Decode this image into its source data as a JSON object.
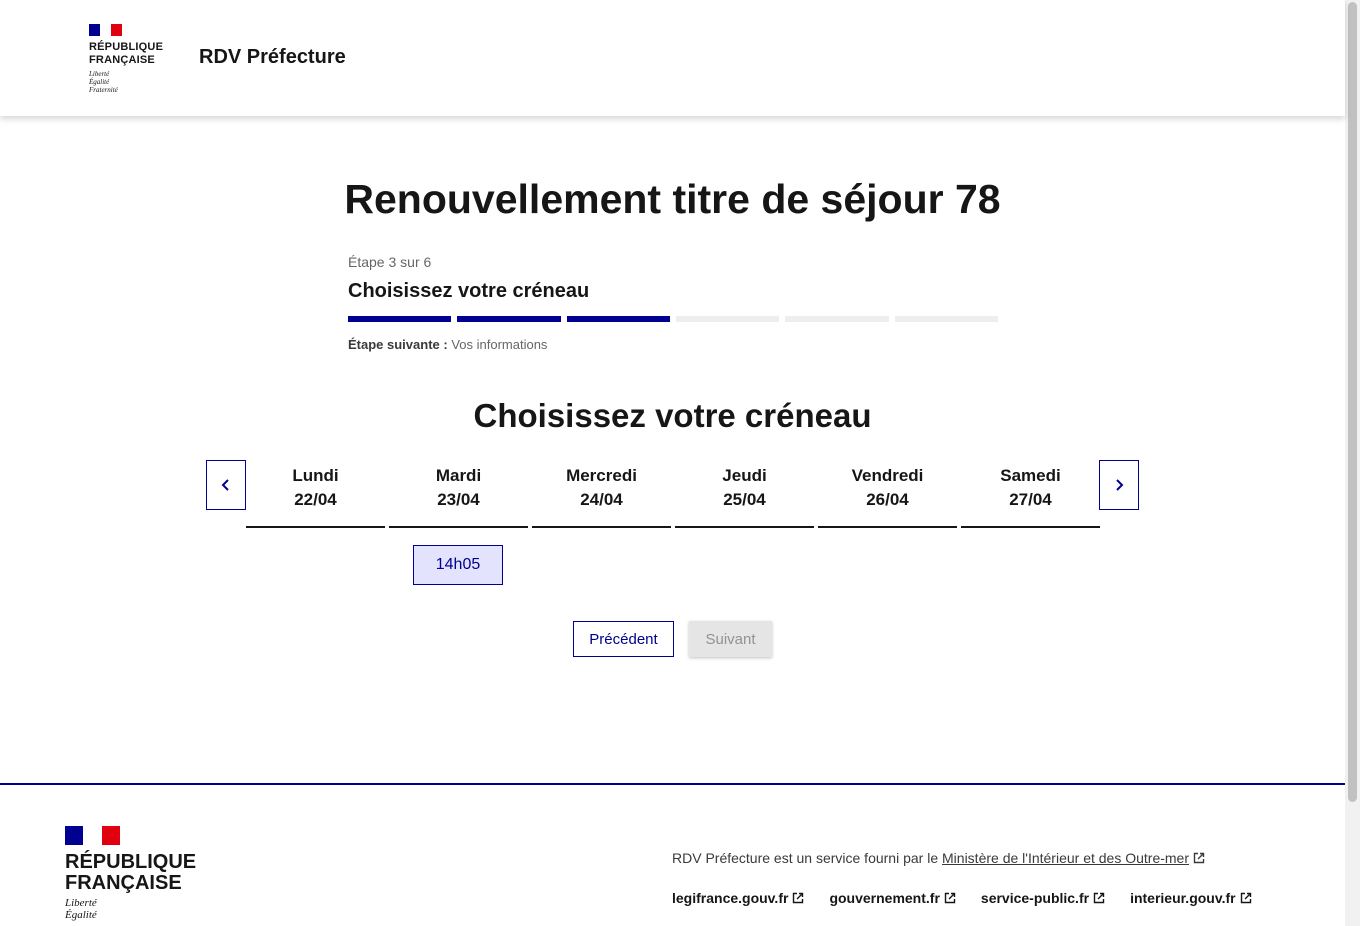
{
  "header": {
    "logo_line1": "RÉPUBLIQUE",
    "logo_line2": "FRANÇAISE",
    "motto": [
      "Liberté",
      "Égalité",
      "Fraternité"
    ],
    "service_name": "RDV Préfecture"
  },
  "main": {
    "title": "Renouvellement titre de séjour 78",
    "stepper": {
      "state": "Étape 3 sur 6",
      "title": "Choisissez votre créneau",
      "current_step": 3,
      "total_steps": 6,
      "next_label": "Étape suivante :",
      "next_value": "Vos informations"
    },
    "section_title": "Choisissez votre créneau",
    "days": [
      {
        "name": "Lundi",
        "date": "22/04"
      },
      {
        "name": "Mardi",
        "date": "23/04"
      },
      {
        "name": "Mercredi",
        "date": "24/04"
      },
      {
        "name": "Jeudi",
        "date": "25/04"
      },
      {
        "name": "Vendredi",
        "date": "26/04"
      },
      {
        "name": "Samedi",
        "date": "27/04"
      }
    ],
    "slots": [
      {
        "day": "Mardi",
        "time": "14h05"
      }
    ],
    "buttons": {
      "previous": "Précédent",
      "next": "Suivant"
    }
  },
  "footer": {
    "logo_line1": "RÉPUBLIQUE",
    "logo_line2": "FRANÇAISE",
    "motto": [
      "Liberté",
      "Égalité"
    ],
    "description_prefix": "RDV Préfecture est un service fourni par le",
    "ministry_link": "Ministère de l'Intérieur et des Outre-mer",
    "links": [
      "legifrance.gouv.fr",
      "gouvernement.fr",
      "service-public.fr",
      "interieur.gouv.fr"
    ]
  },
  "colors": {
    "primary": "#000091",
    "slot_bg": "#e3e3fd",
    "flag_red": "#e1000f",
    "disabled_bg": "#e5e5e5"
  }
}
